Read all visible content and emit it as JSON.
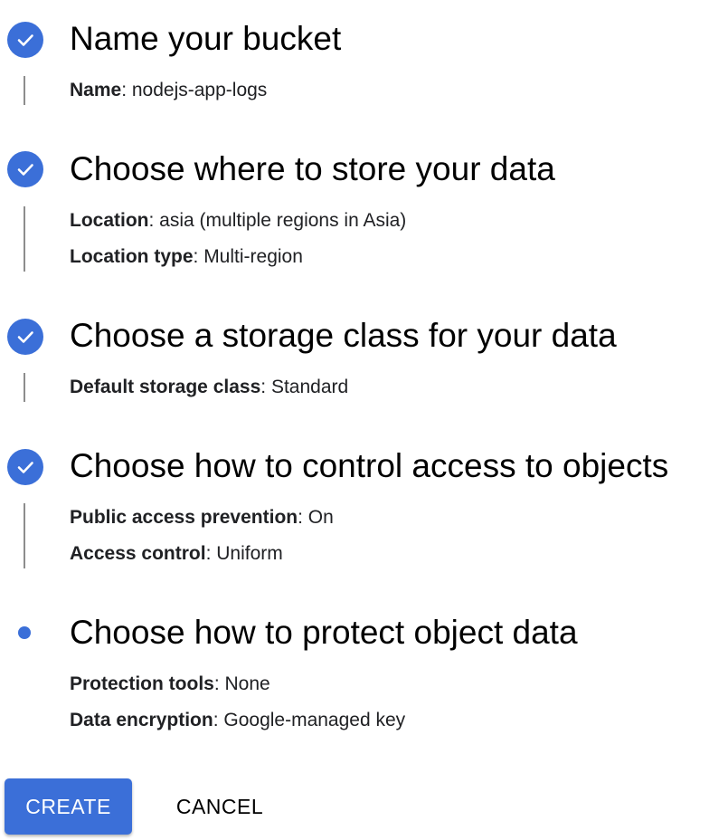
{
  "steps": [
    {
      "title": "Name your bucket",
      "status": "complete",
      "details": [
        {
          "key": "Name",
          "value": "nodejs-app-logs"
        }
      ]
    },
    {
      "title": "Choose where to store your data",
      "status": "complete",
      "details": [
        {
          "key": "Location",
          "value": "asia (multiple regions in Asia)"
        },
        {
          "key": "Location type",
          "value": "Multi-region"
        }
      ]
    },
    {
      "title": "Choose a storage class for your data",
      "status": "complete",
      "details": [
        {
          "key": "Default storage class",
          "value": "Standard"
        }
      ]
    },
    {
      "title": "Choose how to control access to objects",
      "status": "complete",
      "details": [
        {
          "key": "Public access prevention",
          "value": "On"
        },
        {
          "key": "Access control",
          "value": "Uniform"
        }
      ]
    },
    {
      "title": "Choose how to protect object data",
      "status": "current",
      "details": [
        {
          "key": "Protection tools",
          "value": "None"
        },
        {
          "key": "Data encryption",
          "value": "Google-managed key"
        }
      ]
    }
  ],
  "separator": ": ",
  "actions": {
    "create_label": "CREATE",
    "cancel_label": "CANCEL"
  },
  "colors": {
    "accent": "#3b6fd8",
    "connector": "#8d8d8d",
    "text": "#202124"
  },
  "icons": {
    "complete": "check-circle-icon",
    "current": "dot-icon"
  }
}
